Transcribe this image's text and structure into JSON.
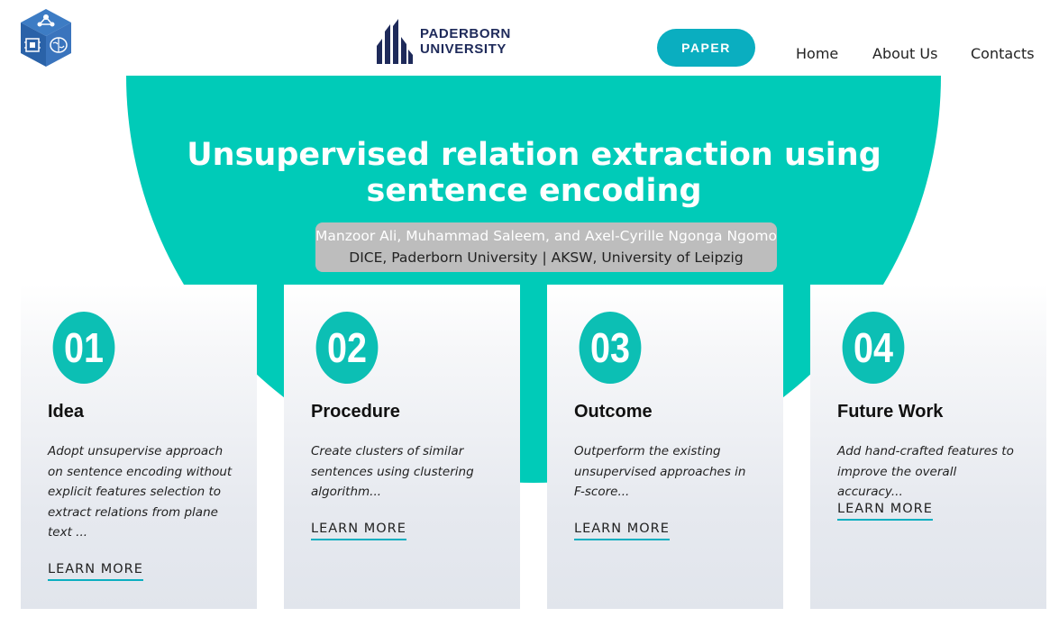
{
  "header": {
    "university": {
      "line1": "PADERBORN",
      "line2": "UNIVERSITY"
    },
    "paper_button": "PAPER",
    "nav": [
      {
        "label": "Home"
      },
      {
        "label": "About Us"
      },
      {
        "label": "Contacts"
      }
    ],
    "logo_icon": "dice-cube-icon"
  },
  "hero": {
    "title_line1": "Unsupervised relation extraction using",
    "title_line2": "sentence encoding",
    "authors": "Manzoor Ali, Muhammad Saleem, and Axel-Cyrille Ngonga Ngomo",
    "affiliation": "DICE, Paderborn University | AKSW, University of Leipzig",
    "accent_color": "#00cbb8"
  },
  "cards": [
    {
      "number": "01",
      "title": "Idea",
      "description": "Adopt unsupervise approach on sentence encoding without explicit features selection to extract relations from plane text ...",
      "link": "LEARN MORE"
    },
    {
      "number": "02",
      "title": "Procedure",
      "description": "Create clusters of similar sentences using clustering algorithm...",
      "link": "LEARN MORE"
    },
    {
      "number": "03",
      "title": "Outcome",
      "description": "Outperform the existing unsupervised approaches in F-score...",
      "link": "LEARN MORE"
    },
    {
      "number": "04",
      "title": "Future Work",
      "description": "Add hand-crafted features to improve the overall accuracy...",
      "link": "LEARN MORE"
    }
  ],
  "colors": {
    "button": "#0aaec0",
    "circle": "#0cbfb4",
    "navy": "#1e2a5a",
    "logo_blue": "#2f6db3"
  }
}
